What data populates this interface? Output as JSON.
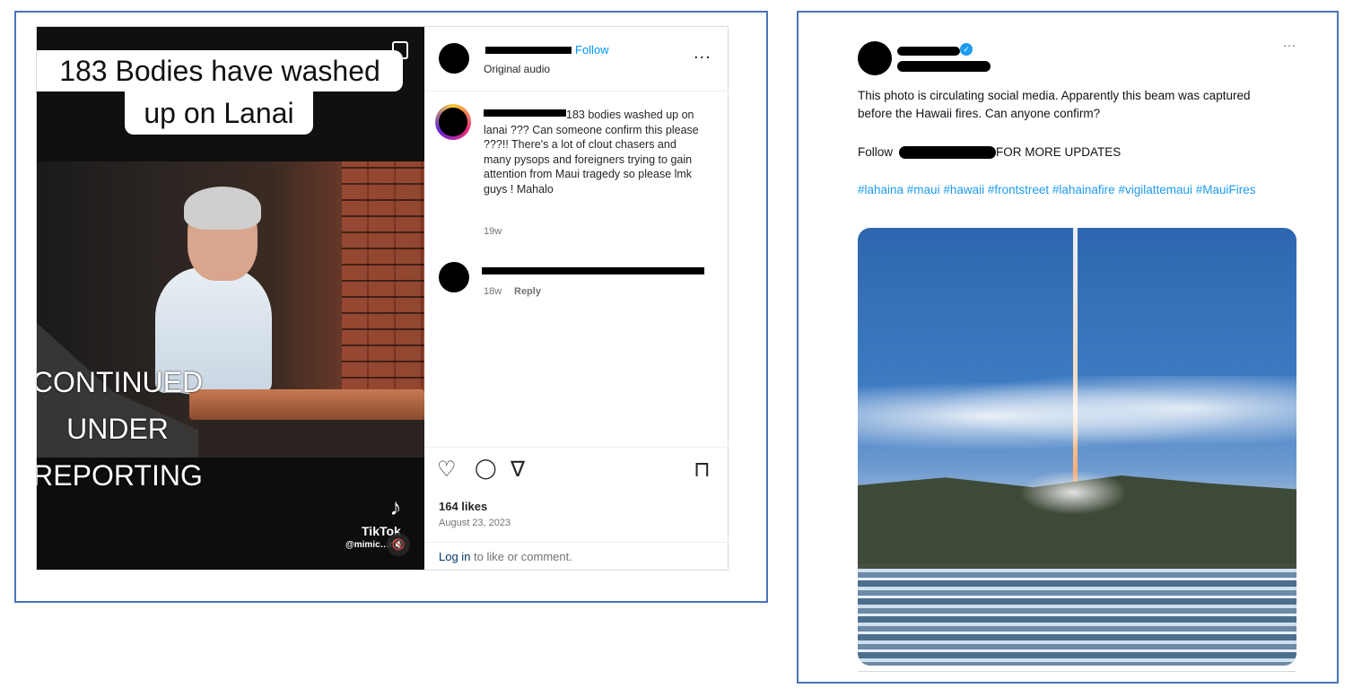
{
  "instagram": {
    "video": {
      "caption_line1": "183 Bodies have washed",
      "caption_line2": "up on Lanai",
      "overlay_text": [
        "CONTINUED",
        "UNDER",
        "REPORTING"
      ],
      "tiktok_logo_glyph": "♪",
      "tiktok_word": "TikTok",
      "tiktok_user": "@mimic…n6",
      "mute_icon_glyph": "🔇"
    },
    "header": {
      "follow_label": "Follow",
      "audio_label": "Original audio",
      "more_glyph": "..."
    },
    "comment": {
      "text": "183 bodies washed up on lanai ??? Can someone confirm this please ???!! There's a lot of clout chasers and many pysops and foreigners trying to gain attention from Maui tragedy so please lmk guys ! Mahalo",
      "time": "19w"
    },
    "reply": {
      "time": "18w",
      "reply_label": "Reply"
    },
    "actions": {
      "like_glyph": "♡",
      "comment_glyph": "◯",
      "share_glyph": "∇",
      "save_glyph": "⊓",
      "likes": "164 likes",
      "date": "August 23, 2023"
    },
    "login": {
      "link": "Log in",
      "rest": " to like or comment."
    }
  },
  "twitter": {
    "more_glyph": "···",
    "verified_glyph": "✓",
    "text": "This photo is circulating social media. Apparently this beam was captured before the Hawaii fires. Can anyone confirm?",
    "follow_prefix": "Follow",
    "follow_suffix": "FOR MORE UPDATES",
    "hashtags": "#lahaina #maui #hawaii #frontstreet #lahainafire #vigilattemaui #MauiFires"
  },
  "colors": {
    "frame_border": "#4a74b8",
    "ig_link_blue": "#0095f6",
    "tw_link_blue": "#1d9bf0"
  }
}
